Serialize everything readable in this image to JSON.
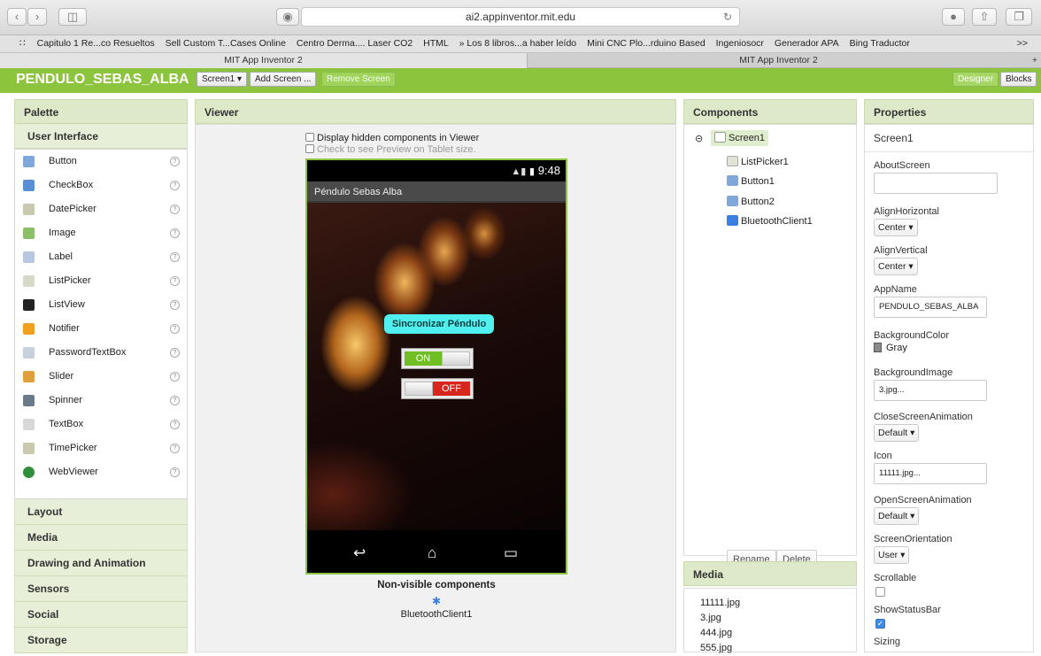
{
  "browser": {
    "url": "ai2.appinventor.mit.edu",
    "bookmarks": [
      "Capitulo 1 Re...co Resueltos",
      "Sell Custom T...Cases Online",
      "Centro Derma.... Laser CO2",
      "HTML",
      "» Los 8 libros...a haber leído",
      "Mini CNC Plo...rduino Based",
      "Ingeniosocr",
      "Generador APA",
      "Bing Traductor"
    ],
    "tabs": [
      "MIT App Inventor 2",
      "MIT App Inventor 2"
    ]
  },
  "app": {
    "project_name": "PENDULO_SEBAS_ALBA",
    "screen_select": "Screen1 ▾",
    "add_screen": "Add Screen ...",
    "remove_screen": "Remove Screen",
    "designer": "Designer",
    "blocks": "Blocks"
  },
  "palette": {
    "title": "Palette",
    "section": "User Interface",
    "items": [
      {
        "label": "Button",
        "color": "#7fa7d9"
      },
      {
        "label": "CheckBox",
        "color": "#5b8fd4"
      },
      {
        "label": "DatePicker",
        "color": "#c9c9b0"
      },
      {
        "label": "Image",
        "color": "#8bbf6a"
      },
      {
        "label": "Label",
        "color": "#b8c7e0"
      },
      {
        "label": "ListPicker",
        "color": "#d8d8c8"
      },
      {
        "label": "ListView",
        "color": "#222222"
      },
      {
        "label": "Notifier",
        "color": "#f0a020"
      },
      {
        "label": "PasswordTextBox",
        "color": "#c8d0dc"
      },
      {
        "label": "Slider",
        "color": "#e0a040"
      },
      {
        "label": "Spinner",
        "color": "#6a7a8a"
      },
      {
        "label": "TextBox",
        "color": "#d8d8d8"
      },
      {
        "label": "TimePicker",
        "color": "#c9c9b0"
      },
      {
        "label": "WebViewer",
        "color": "#2f8f3a"
      }
    ],
    "help": "?",
    "categories": [
      "Layout",
      "Media",
      "Drawing and Animation",
      "Sensors",
      "Social",
      "Storage"
    ]
  },
  "viewer": {
    "title": "Viewer",
    "display_hidden": "Display hidden components in Viewer",
    "tablet_preview": "Check to see Preview on Tablet size.",
    "status_time": "9:48",
    "screen_title": "Péndulo Sebas Alba",
    "sync_button": "Sincronizar Péndulo",
    "toggle_on": "ON",
    "toggle_off": "OFF",
    "nonvisible_title": "Non-visible components",
    "nonvisible_item": "BluetoothClient1"
  },
  "components": {
    "title": "Components",
    "tree": [
      "Screen1",
      "ListPicker1",
      "Button1",
      "Button2",
      "BluetoothClient1"
    ],
    "rename": "Rename",
    "delete": "Delete"
  },
  "media": {
    "title": "Media",
    "files": [
      "11111.jpg",
      "3.jpg",
      "444.jpg",
      "555.jpg"
    ]
  },
  "properties": {
    "title": "Properties",
    "component": "Screen1",
    "about_screen": "AboutScreen",
    "align_horizontal": "AlignHorizontal",
    "align_horizontal_value": "Center ▾",
    "align_vertical": "AlignVertical",
    "align_vertical_value": "Center ▾",
    "app_name": "AppName",
    "app_name_value": "PENDULO_SEBAS_ALBA",
    "background_color": "BackgroundColor",
    "background_color_value": "Gray",
    "background_image": "BackgroundImage",
    "background_image_value": "3.jpg...",
    "close_animation": "CloseScreenAnimation",
    "close_animation_value": "Default ▾",
    "icon": "Icon",
    "icon_value": "11111.jpg...",
    "open_animation": "OpenScreenAnimation",
    "open_animation_value": "Default ▾",
    "orientation": "ScreenOrientation",
    "orientation_value": "User ▾",
    "scrollable": "Scrollable",
    "show_status_bar": "ShowStatusBar",
    "sizing": "Sizing"
  }
}
